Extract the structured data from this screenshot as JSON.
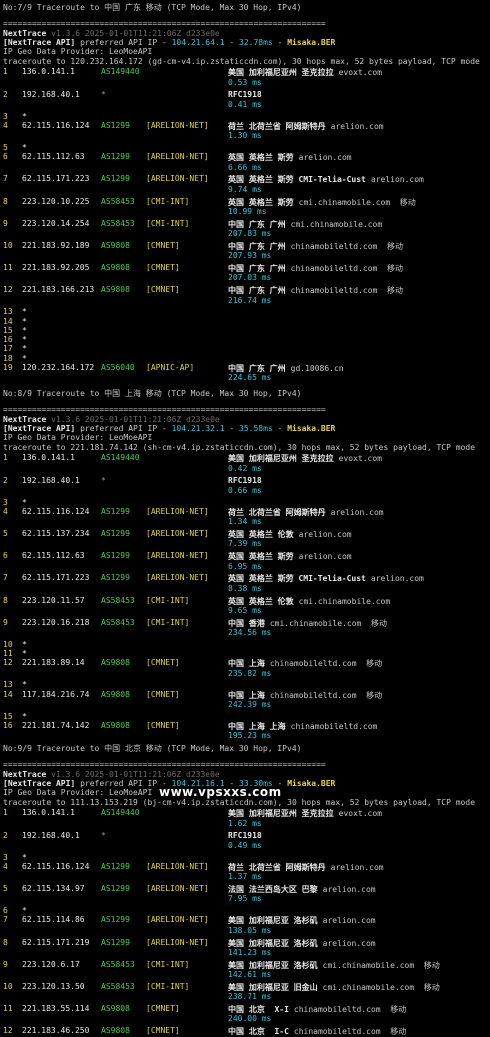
{
  "watermark": "www.vpsxxs.com",
  "blocks": [
    {
      "header": "No:7/9 Traceroute to 中国 广东 移动 (TCP Mode, Max 30 Hop, IPv4)",
      "rule": "===================================================================",
      "tool_name": "NextTrace",
      "tool_version": " v1.3.6 2025-01-01T11:21:06Z d233e0e",
      "api_prefix": "[NextTrace API]",
      "api_text": " preferred API IP - ",
      "api_ip": "104.21.64.1",
      "api_sep": " - ",
      "api_ms": "32.78ms",
      "api_sep2": " - ",
      "api_node": "Misaka.BER",
      "geo_provider": "IP Geo Data Provider: LeoMoeAPI",
      "traceroute_line": "traceroute to 120.232.164.172 (gd-cm-v4.ip.zstaticcdn.com), 30 hops max, 52 bytes payload, TCP mode",
      "rows": [
        {
          "hop": "1",
          "ip": "136.0.141.1",
          "asn": "AS149440",
          "tag": "",
          "geo": "美国 加利福尼亚州 圣克拉拉",
          "host": "evoxt.com",
          "ms": "0.53 ms"
        },
        {
          "hop": "2",
          "ip": "192.168.40.1",
          "asn": "*",
          "tag": "",
          "geo": "RFC1918",
          "host": "",
          "ms": "0.41 ms"
        },
        {
          "hop": "3",
          "ip": "*"
        },
        {
          "hop": "4",
          "ip": "62.115.116.124",
          "asn": "AS1299",
          "tag": "[ARELION-NET]",
          "geo": "荷兰 北荷兰省 阿姆斯特丹",
          "host": "arelion.com",
          "ms": "1.30 ms"
        },
        {
          "hop": "5",
          "ip": "*"
        },
        {
          "hop": "6",
          "ip": "62.115.112.63",
          "asn": "AS1299",
          "tag": "[ARELION-NET]",
          "geo": "英国 英格兰 斯劳",
          "host": "arelion.com",
          "ms": "6.66 ms"
        },
        {
          "hop": "7",
          "ip": "62.115.171.223",
          "asn": "AS1299",
          "tag": "[ARELION-NET]",
          "geo": "英国 英格兰 斯劳 CMI-Telia-Cust",
          "host": "arelion.com",
          "ms": "9.74 ms"
        },
        {
          "hop": "8",
          "ip": "223.120.10.225",
          "asn": "AS58453",
          "tag": "[CMI-INT]",
          "geo": "英国 英格兰 斯劳",
          "host": "cmi.chinamobile.com  移动",
          "ms": "10.99 ms"
        },
        {
          "hop": "9",
          "ip": "223.120.14.254",
          "asn": "AS58453",
          "tag": "[CMI-INT]",
          "geo": "中国 广东 广州",
          "host": "cmi.chinamobile.com",
          "ms": "207.83 ms"
        },
        {
          "hop": "10",
          "ip": "221.183.92.189",
          "asn": "AS9808",
          "tag": "[CMNET]",
          "geo": "中国 广东 广州",
          "host": "chinamobileltd.com  移动",
          "ms": "207.93 ms"
        },
        {
          "hop": "11",
          "ip": "221.183.92.205",
          "asn": "AS9808",
          "tag": "[CMNET]",
          "geo": "中国 广东 广州",
          "host": "chinamobileltd.com  移动",
          "ms": "207.03 ms"
        },
        {
          "hop": "12",
          "ip": "221.183.166.213",
          "asn": "AS9808",
          "tag": "[CMNET]",
          "geo": "中国 广东 广州",
          "host": "chinamobileltd.com  移动",
          "ms": "216.74 ms"
        },
        {
          "hop": "13",
          "ip": "*"
        },
        {
          "hop": "14",
          "ip": "*"
        },
        {
          "hop": "15",
          "ip": "*"
        },
        {
          "hop": "16",
          "ip": "*"
        },
        {
          "hop": "17",
          "ip": "*"
        },
        {
          "hop": "18",
          "ip": "*"
        },
        {
          "hop": "19",
          "ip": "120.232.164.172",
          "asn": "AS56040",
          "tag": "[APNIC-AP]",
          "geo": "中国 广东 广州",
          "host": "gd.10086.cn",
          "ms": "224.65 ms"
        }
      ]
    },
    {
      "header": "No:8/9 Traceroute to 中国 上海 移动 (TCP Mode, Max 30 Hop, IPv4)",
      "rule": "===================================================================",
      "tool_name": "NextTrace",
      "tool_version": " v1.3.6 2025-01-01T11:21:06Z d233e0e",
      "api_prefix": "[NextTrace API]",
      "api_text": " preferred API IP - ",
      "api_ip": "104.21.32.1",
      "api_sep": " - ",
      "api_ms": "35.58ms",
      "api_sep2": " - ",
      "api_node": "Misaka.BER",
      "geo_provider": "IP Geo Data Provider: LeoMoeAPI",
      "traceroute_line": "traceroute to 221.181.74.142 (sh-cm-v4.ip.zstaticcdn.com), 30 hops max, 52 bytes payload, TCP mode",
      "rows": [
        {
          "hop": "1",
          "ip": "136.0.141.1",
          "asn": "AS149440",
          "tag": "",
          "geo": "美国 加利福尼亚州 圣克拉拉",
          "host": "evoxt.com",
          "ms": "0.42 ms"
        },
        {
          "hop": "2",
          "ip": "192.168.40.1",
          "asn": "*",
          "tag": "",
          "geo": "RFC1918",
          "host": "",
          "ms": "0.66 ms"
        },
        {
          "hop": "3",
          "ip": "*"
        },
        {
          "hop": "4",
          "ip": "62.115.116.124",
          "asn": "AS1299",
          "tag": "[ARELION-NET]",
          "geo": "荷兰 北荷兰省 阿姆斯特丹",
          "host": "arelion.com",
          "ms": "1.34 ms"
        },
        {
          "hop": "5",
          "ip": "62.115.137.234",
          "asn": "AS1299",
          "tag": "[ARELION-NET]",
          "geo": "英国 英格兰 伦敦",
          "host": "arelion.com",
          "ms": "7.39 ms"
        },
        {
          "hop": "6",
          "ip": "62.115.112.63",
          "asn": "AS1299",
          "tag": "[ARELION-NET]",
          "geo": "英国 英格兰 斯劳",
          "host": "arelion.com",
          "ms": "6.95 ms"
        },
        {
          "hop": "7",
          "ip": "62.115.171.223",
          "asn": "AS1299",
          "tag": "[ARELION-NET]",
          "geo": "英国 英格兰 斯劳 CMI-Telia-Cust",
          "host": "arelion.com",
          "ms": "8.38 ms"
        },
        {
          "hop": "8",
          "ip": "223.120.11.57",
          "asn": "AS58453",
          "tag": "[CMI-INT]",
          "geo": "英国 英格兰 伦敦",
          "host": "cmi.chinamobile.com",
          "ms": "9.65 ms"
        },
        {
          "hop": "9",
          "ip": "223.120.16.218",
          "asn": "AS58453",
          "tag": "[CMI-INT]",
          "geo": "中国 香港",
          "host": "cmi.chinamobile.com  移动",
          "ms": "234.56 ms"
        },
        {
          "hop": "10",
          "ip": "*"
        },
        {
          "hop": "11",
          "ip": "*"
        },
        {
          "hop": "12",
          "ip": "221.183.89.14",
          "asn": "AS9808",
          "tag": "[CMNET]",
          "geo": "中国 上海",
          "host": "chinamobileltd.com  移动",
          "ms": "235.82 ms"
        },
        {
          "hop": "13",
          "ip": "*"
        },
        {
          "hop": "14",
          "ip": "117.184.216.74",
          "asn": "AS9808",
          "tag": "[CMNET]",
          "geo": "中国 上海",
          "host": "chinamobileltd.com  移动",
          "ms": "242.39 ms"
        },
        {
          "hop": "15",
          "ip": "*"
        },
        {
          "hop": "16",
          "ip": "221.181.74.142",
          "asn": "AS9808",
          "tag": "[CMNET]",
          "geo": "中国 上海 上海",
          "host": "chinamobileltd.com",
          "ms": "195.23 ms"
        }
      ]
    },
    {
      "header": "No:9/9 Traceroute to 中国 北京 移动 (TCP Mode, Max 30 Hop, IPv4)",
      "rule": "===================================================================",
      "tool_name": "NextTrace",
      "tool_version": " v1.3.6 2025-01-01T11:21:06Z d233e0e",
      "api_prefix": "[NextTrace API]",
      "api_text": " preferred API IP - ",
      "api_ip": "104.21.16.1",
      "api_sep": " - ",
      "api_ms": "33.30ms",
      "api_sep2": " - ",
      "api_node": "Misaka.BER",
      "geo_provider": "IP Geo Data Provider: LeoMoeAPI",
      "traceroute_line": "traceroute to 111.13.153.219 (bj-cm-v4.ip.zstaticcdn.com), 30 hops max, 52 bytes payload, TCP mode",
      "rows": [
        {
          "hop": "1",
          "ip": "136.0.141.1",
          "asn": "AS149440",
          "tag": "",
          "geo": "美国 加利福尼亚州 圣克拉拉",
          "host": "evoxt.com",
          "ms": "1.62 ms"
        },
        {
          "hop": "2",
          "ip": "192.168.40.1",
          "asn": "*",
          "tag": "",
          "geo": "RFC1918",
          "host": "",
          "ms": "0.49 ms"
        },
        {
          "hop": "3",
          "ip": "*"
        },
        {
          "hop": "4",
          "ip": "62.115.116.124",
          "asn": "AS1299",
          "tag": "[ARELION-NET]",
          "geo": "荷兰 北荷兰省 阿姆斯特丹",
          "host": "arelion.com",
          "ms": "1.37 ms"
        },
        {
          "hop": "5",
          "ip": "62.115.134.97",
          "asn": "AS1299",
          "tag": "[ARELION-NET]",
          "geo": "法国 法兰西岛大区 巴黎",
          "host": "arelion.com",
          "ms": "7.95 ms"
        },
        {
          "hop": "6",
          "ip": "*"
        },
        {
          "hop": "7",
          "ip": "62.115.114.86",
          "asn": "AS1299",
          "tag": "[ARELION-NET]",
          "geo": "美国 加利福尼亚 洛杉矶",
          "host": "arelion.com",
          "ms": "138.05 ms"
        },
        {
          "hop": "8",
          "ip": "62.115.171.219",
          "asn": "AS1299",
          "tag": "[ARELION-NET]",
          "geo": "美国 加利福尼亚 洛杉矶",
          "host": "arelion.com",
          "ms": "141.23 ms"
        },
        {
          "hop": "9",
          "ip": "223.120.6.17",
          "asn": "AS58453",
          "tag": "[CMI-INT]",
          "geo": "美国 加利福尼亚 洛杉矶",
          "host": "cmi.chinamobile.com  移动",
          "ms": "142.61 ms"
        },
        {
          "hop": "10",
          "ip": "223.120.13.50",
          "asn": "AS58453",
          "tag": "[CMI-INT]",
          "geo": "美国 加利福尼亚 旧金山",
          "host": "cmi.chinamobile.com  移动",
          "ms": "238.71 ms"
        },
        {
          "hop": "11",
          "ip": "221.183.55.114",
          "asn": "AS9808",
          "tag": "[CMNET]",
          "geo": "中国 北京  X-I",
          "host": "chinamobileltd.com  移动",
          "ms": "240.00 ms"
        },
        {
          "hop": "12",
          "ip": "221.183.46.250",
          "asn": "AS9808",
          "tag": "[CMNET]",
          "geo": "中国 北京  I-C",
          "host": "chinamobileltd.com  移动",
          "ms": ""
        }
      ]
    }
  ]
}
